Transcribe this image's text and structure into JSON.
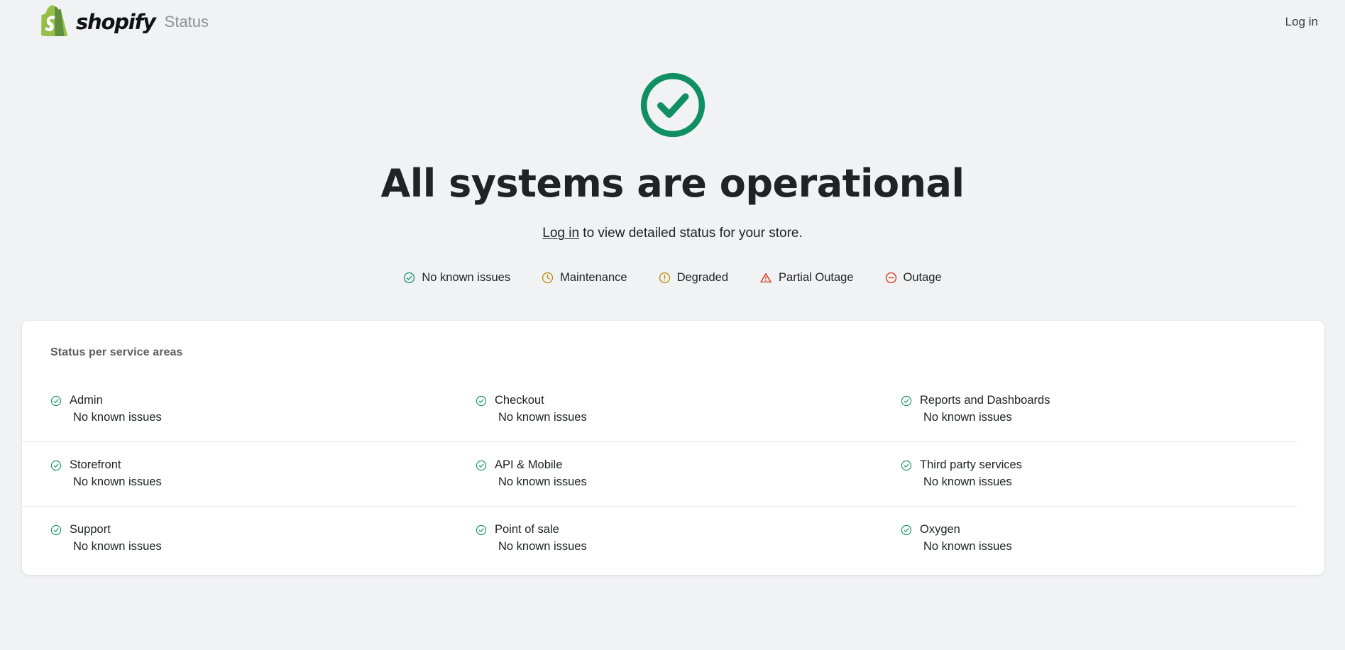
{
  "header": {
    "brand_wordmark": "shopify",
    "brand_subtitle": "Status",
    "logo_icon": "shopify-bag-logo",
    "login_label": "Log in"
  },
  "hero": {
    "status_icon": "check-circle-icon",
    "title": "All systems are operational",
    "subtitle_link": "Log in",
    "subtitle_rest": " to view detailed status for your store."
  },
  "legend": {
    "items": [
      {
        "label": "No known issues",
        "icon": "check-circle-icon",
        "color": "#108f62"
      },
      {
        "label": "Maintenance",
        "icon": "clock-icon",
        "color": "#b98900"
      },
      {
        "label": "Degraded",
        "icon": "exclamation-circle-icon",
        "color": "#b98900"
      },
      {
        "label": "Partial Outage",
        "icon": "warning-triangle-icon",
        "color": "#d72c0d"
      },
      {
        "label": "Outage",
        "icon": "minus-circle-icon",
        "color": "#d72c0d"
      }
    ]
  },
  "card": {
    "title": "Status per service areas",
    "services": [
      {
        "name": "Admin",
        "status": "No known issues",
        "icon": "check-circle-icon"
      },
      {
        "name": "Checkout",
        "status": "No known issues",
        "icon": "check-circle-icon"
      },
      {
        "name": "Reports and Dashboards",
        "status": "No known issues",
        "icon": "check-circle-icon"
      },
      {
        "name": "Storefront",
        "status": "No known issues",
        "icon": "check-circle-icon"
      },
      {
        "name": "API & Mobile",
        "status": "No known issues",
        "icon": "check-circle-icon"
      },
      {
        "name": "Third party services",
        "status": "No known issues",
        "icon": "check-circle-icon"
      },
      {
        "name": "Support",
        "status": "No known issues",
        "icon": "check-circle-icon"
      },
      {
        "name": "Point of sale",
        "status": "No known issues",
        "icon": "check-circle-icon"
      },
      {
        "name": "Oxygen",
        "status": "No known issues",
        "icon": "check-circle-icon"
      }
    ]
  },
  "colors": {
    "page_background": "#f1f2f4",
    "card_background": "#ffffff",
    "operational_green": "#108f62",
    "brand_green": "#95bf47",
    "text": "#202223",
    "muted_text": "#5c5f62"
  }
}
